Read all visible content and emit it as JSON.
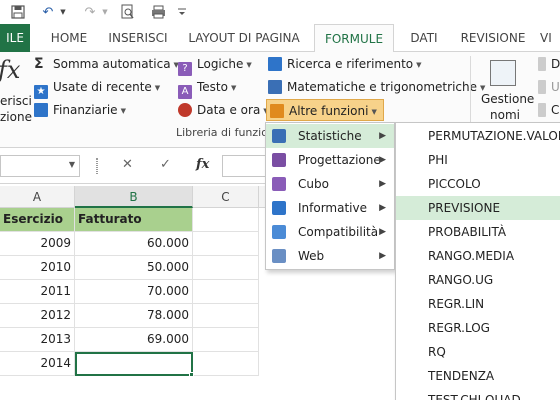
{
  "tabs": {
    "file": "ILE",
    "home": "HOME",
    "insert": "INSERISCI",
    "page_layout": "LAYOUT DI PAGINA",
    "formulas": "FORMULE",
    "data": "DATI",
    "review": "REVISIONE",
    "view": "VI"
  },
  "ribbon": {
    "insert_function_partial": [
      "erisci",
      "zione"
    ],
    "library": {
      "autosum": "Somma automatica",
      "recent": "Usate di recente",
      "financial": "Finanziarie",
      "logical": "Logiche",
      "text": "Testo",
      "datetime": "Data e ora",
      "lookup": "Ricerca e riferimento",
      "math": "Matematiche e trigonometriche",
      "more_functions": "Altre funzioni",
      "group_label": "Libreria di funzion"
    },
    "names": {
      "manager_line1": "Gestione",
      "manager_line2": "nomi",
      "partial_letters": [
        "D",
        "U",
        "C"
      ]
    }
  },
  "formula_bar": {
    "cancel": "✕",
    "confirm": "✓",
    "fx": "fx"
  },
  "columns": [
    "A",
    "B",
    "C"
  ],
  "sheet": {
    "header": {
      "year": "Esercizio",
      "revenue": "Fatturato"
    },
    "rows": [
      {
        "year": "2009",
        "revenue": "60.000"
      },
      {
        "year": "2010",
        "revenue": "50.000"
      },
      {
        "year": "2011",
        "revenue": "70.000"
      },
      {
        "year": "2012",
        "revenue": "78.000"
      },
      {
        "year": "2013",
        "revenue": "69.000"
      },
      {
        "year": "2014",
        "revenue": ""
      }
    ]
  },
  "more_functions_menu": [
    {
      "label": "Statistiche",
      "color": "#3a6fb5"
    },
    {
      "label": "Progettazione",
      "color": "#7a4ea3"
    },
    {
      "label": "Cubo",
      "color": "#8a5cb8"
    },
    {
      "label": "Informative",
      "color": "#2e74c9"
    },
    {
      "label": "Compatibilità",
      "color": "#4b8bd6"
    },
    {
      "label": "Web",
      "color": "#6a8fc4"
    }
  ],
  "statistical_functions": [
    "PERMUTAZIONE.VALORI",
    "PHI",
    "PICCOLO",
    "PREVISIONE",
    "PROBABILITÀ",
    "RANGO.MEDIA",
    "RANGO.UG",
    "REGR.LIN",
    "REGR.LOG",
    "RQ",
    "TENDENZA",
    "TEST.CHI.QUAD"
  ],
  "colors": {
    "excel_green": "#217346",
    "header_fill": "#a9d08e",
    "menu_highlight": "#d5ecd8"
  }
}
